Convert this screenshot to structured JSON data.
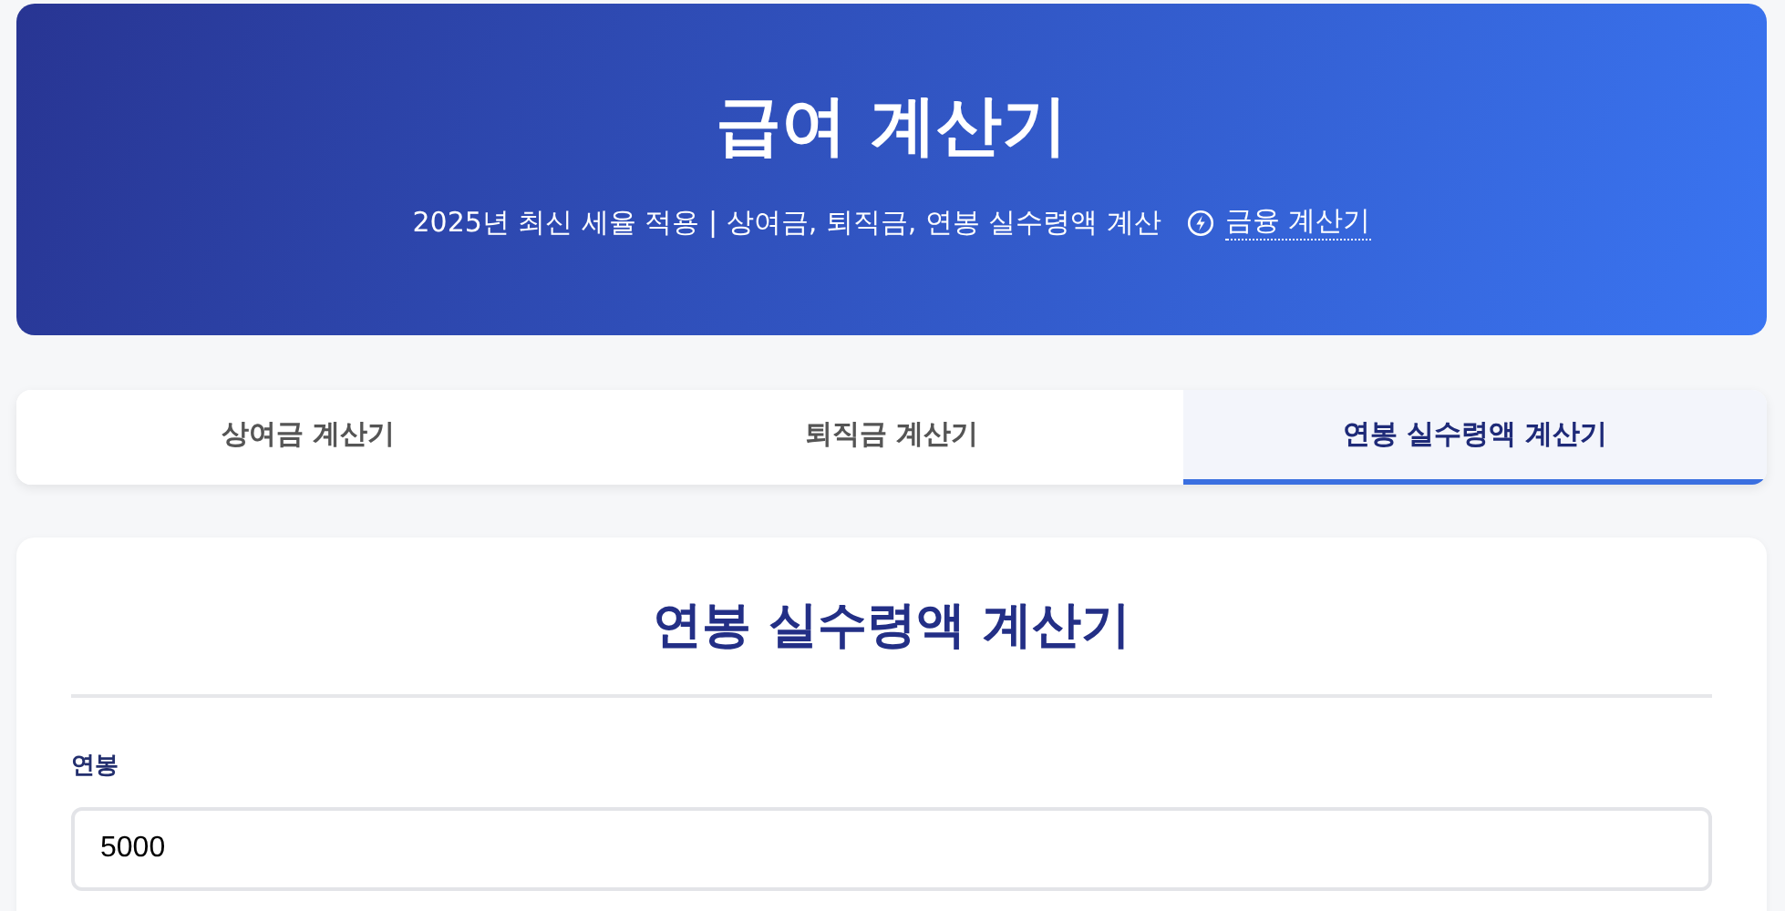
{
  "header": {
    "title": "급여 계산기",
    "subtitle": "2025년 최신 세율 적용 | 상여금, 퇴직금, 연봉 실수령액 계산",
    "link": "금융 계산기"
  },
  "tabs": [
    {
      "label": "상여금 계산기",
      "selected": false
    },
    {
      "label": "퇴직금 계산기",
      "selected": false
    },
    {
      "label": "연봉 실수령액 계산기",
      "selected": true
    }
  ],
  "panel": {
    "title": "연봉 실수령액 계산기",
    "field": {
      "label": "연봉",
      "value": "5000"
    }
  }
}
